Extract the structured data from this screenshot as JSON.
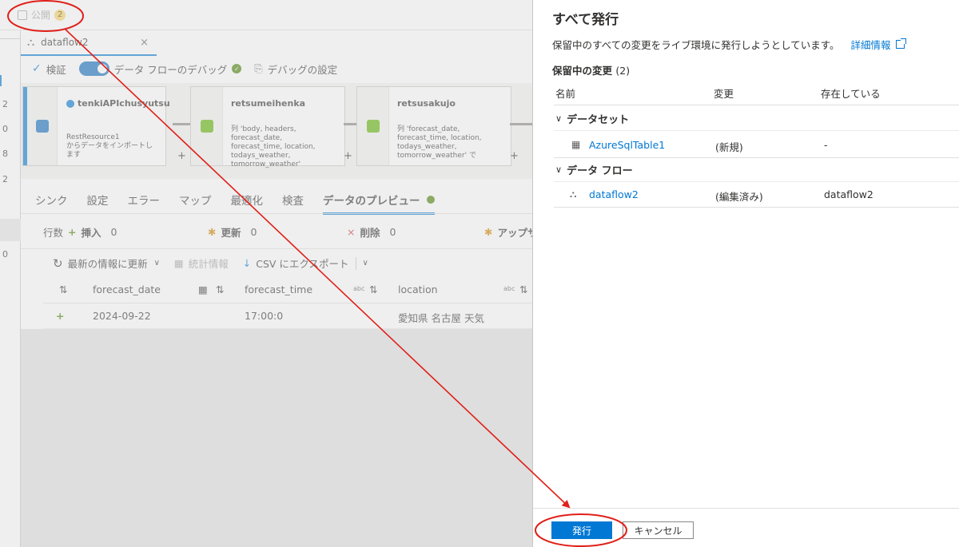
{
  "topbar": {
    "publish_label": "公開",
    "publish_badge": "2"
  },
  "doc_tab": {
    "name": "dataflow2",
    "close": "×"
  },
  "toolbar": {
    "validate": "検証",
    "debug_toggle": "データ フローのデバッグ",
    "debug_settings": "デバッグの設定"
  },
  "left_rail": {
    "numbers": [
      "2",
      "0",
      "8",
      "2",
      "0"
    ]
  },
  "canvas": {
    "nodes": [
      {
        "title": "tenkiAPIchusyutsu",
        "desc": "RestResource1\nからデータをインポートします"
      },
      {
        "title": "retsumeihenka",
        "desc": "列 'body, headers, forecast_date, forecast_time, location, todays_weather, tomorrow_weather'"
      },
      {
        "title": "retsusakujo",
        "desc": "列 'forecast_date, forecast_time, location, todays_weather, tomorrow_weather' で"
      }
    ],
    "plus": "+"
  },
  "tabs": [
    "シンク",
    "設定",
    "エラー",
    "マップ",
    "最適化",
    "検査",
    "データのプレビュー"
  ],
  "stats": {
    "rows_label": "行数",
    "insert_label": "挿入",
    "insert_value": "0",
    "update_label": "更新",
    "update_value": "0",
    "delete_label": "削除",
    "delete_value": "0",
    "upsert_label": "アップサ"
  },
  "cmdbar": {
    "refresh": "最新の情報に更新",
    "stats": "統計情報",
    "export": "CSV にエクスポート"
  },
  "grid": {
    "columns": [
      "forecast_date",
      "forecast_time",
      "location"
    ],
    "type_tag": "abc",
    "rows": [
      {
        "marker": "+",
        "forecast_date": "2024-09-22",
        "forecast_time": "17:00:0",
        "location": "愛知県 名古屋 天気"
      }
    ]
  },
  "panel": {
    "title": "すべて発行",
    "description": "保留中のすべての変更をライブ環境に発行しようとしています。",
    "learn_more": "詳細情報",
    "pending_label": "保留中の変更",
    "pending_count": "(2)",
    "headers": [
      "名前",
      "変更",
      "存在している"
    ],
    "groups": [
      {
        "label": "データセット",
        "items": [
          {
            "name": "AzureSqlTable1",
            "change": "(新規)",
            "existing": "-"
          }
        ]
      },
      {
        "label": "データ フロー",
        "items": [
          {
            "name": "dataflow2",
            "change": "(編集済み)",
            "existing": "dataflow2"
          }
        ]
      }
    ],
    "publish_button": "発行",
    "cancel_button": "キャンセル"
  },
  "colors": {
    "accent": "#0078d4",
    "annotation": "#e0201a",
    "success": "#498205"
  }
}
